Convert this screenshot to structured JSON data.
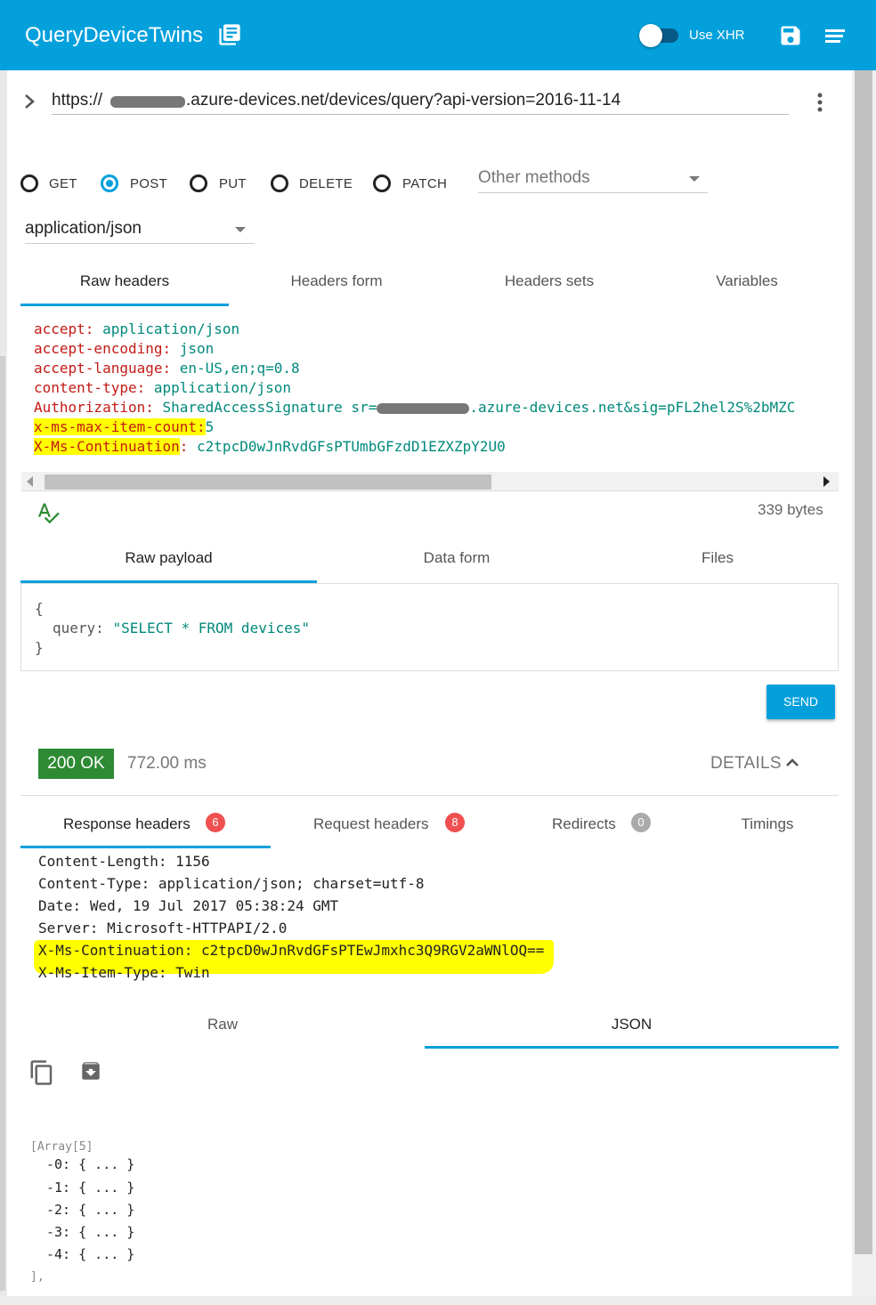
{
  "app": {
    "title": "QueryDeviceTwins",
    "xhr_label": "Use XHR"
  },
  "request": {
    "url_prefix": "https://",
    "url_suffix": ".azure-devices.net/devices/query?api-version=2016-11-14",
    "methods": [
      "GET",
      "POST",
      "PUT",
      "DELETE",
      "PATCH"
    ],
    "selected_method": "POST",
    "other_methods": "Other methods",
    "content_type": "application/json"
  },
  "header_tabs": [
    "Raw headers",
    "Headers form",
    "Headers sets",
    "Variables"
  ],
  "raw_headers": [
    {
      "key": "accept",
      "value": "application/json"
    },
    {
      "key": "accept-encoding",
      "value": "json"
    },
    {
      "key": "accept-language",
      "value": "en-US,en;q=0.8"
    },
    {
      "key": "content-type",
      "value": "application/json"
    },
    {
      "key": "Authorization",
      "value": "SharedAccessSignature sr=",
      "value2": ".azure-devices.net&sig=pFL2hel2S%2bMZC"
    },
    {
      "key": "x-ms-max-item-count",
      "value": "5"
    },
    {
      "key": "X-Ms-Continuation",
      "value": "c2tpcD0wJnRvdGFsPTUmbGFzdD1EZXZpY2U0"
    }
  ],
  "bytes": "339 bytes",
  "payload_tabs": [
    "Raw payload",
    "Data form",
    "Files"
  ],
  "payload": {
    "open": "{",
    "key": "query",
    "value": "\"SELECT * FROM devices\"",
    "close": "}"
  },
  "send_label": "SEND",
  "response": {
    "status": "200 OK",
    "time": "772.00 ms",
    "details": "DETAILS",
    "tabs": [
      {
        "label": "Response headers",
        "count": "6"
      },
      {
        "label": "Request headers",
        "count": "8"
      },
      {
        "label": "Redirects",
        "count": "0"
      },
      {
        "label": "Timings"
      }
    ],
    "headers": [
      {
        "key": "Content-Length:",
        "value": "1156"
      },
      {
        "key": "Content-Type:",
        "value": "application/json; charset=utf-8"
      },
      {
        "key": "Date:",
        "value": "Wed, 19 Jul 2017 05:38:24 GMT"
      },
      {
        "key": "Server:",
        "value": "Microsoft-HTTPAPI/2.0"
      },
      {
        "key": "X-Ms-Continuation:",
        "value": "c2tpcD0wJnRvdGFsPTEwJmxhc3Q9RGV2aWNlOQ=="
      },
      {
        "key": "X-Ms-Item-Type:",
        "value": "Twin"
      }
    ],
    "view_tabs": [
      "Raw",
      "JSON"
    ],
    "json": {
      "array_label": "[Array[5]",
      "items": [
        "0:",
        "1:",
        "2:",
        "3:",
        "4:"
      ],
      "item_value": "{ ... }",
      "close": "],"
    }
  },
  "colors": {
    "accent": "#03a0dc",
    "status_ok": "#2e8b34",
    "badge_red": "#f05050",
    "highlight": "#ffff00"
  }
}
